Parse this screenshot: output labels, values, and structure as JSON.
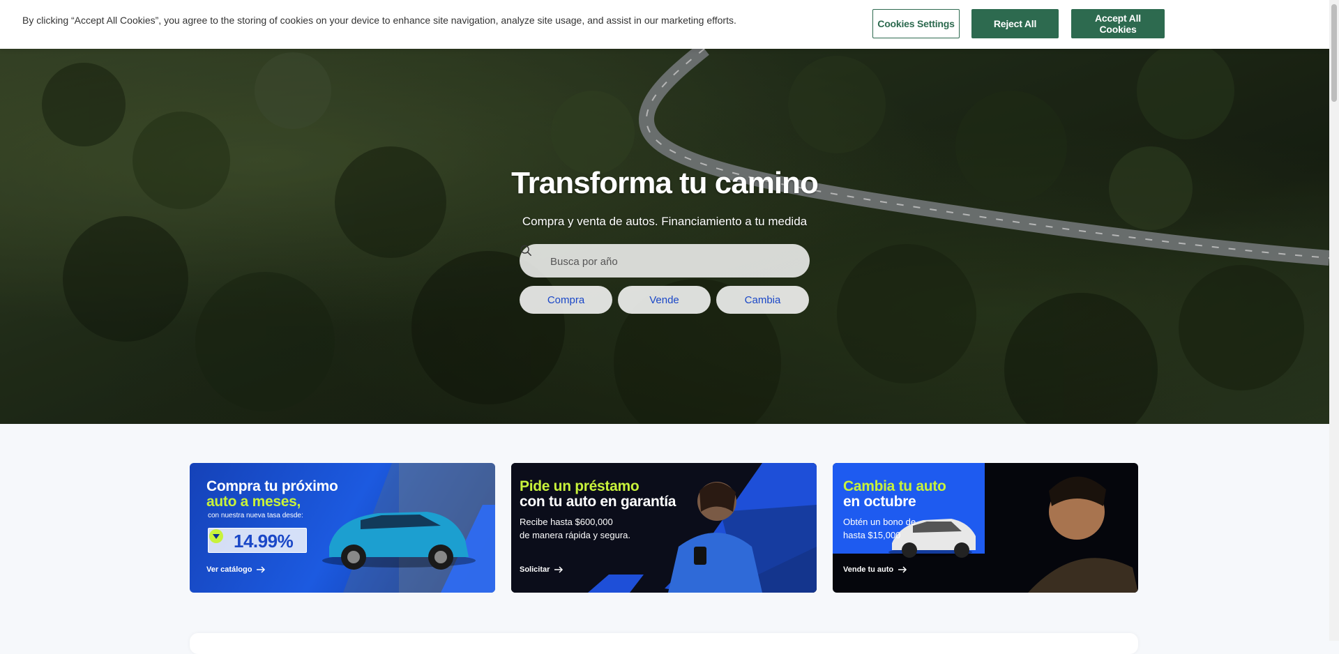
{
  "cookie_banner": {
    "text": "By clicking “Accept All Cookies”, you agree to the storing of cookies on your device to enhance site navigation, analyze site usage, and assist in our marketing efforts.",
    "settings_label": "Cookies Settings",
    "reject_label": "Reject All",
    "accept_label": "Accept All Cookies"
  },
  "hero": {
    "title": "Transforma tu camino",
    "subtitle": "Compra y venta de autos. Financiamiento a tu medida",
    "search_placeholder": "Busca por año",
    "pills": [
      "Compra",
      "Vende",
      "Cambia"
    ]
  },
  "cards": [
    {
      "title_line1": "Compra tu próximo",
      "title_line2": "auto a meses,",
      "small": "con nuestra nueva tasa desde:",
      "rate": "14.99%",
      "link": "Ver catálogo"
    },
    {
      "title_line1": "Pide un préstamo",
      "title_line2": "con tu auto en garantía",
      "desc_line1": "Recibe hasta $600,000",
      "desc_line2": "de manera rápida y segura.",
      "link": "Solicitar"
    },
    {
      "title_line1": "Cambia tu auto",
      "title_line2": "en octubre",
      "desc_line1": "Obtén un bono de",
      "desc_line2": "hasta $15,000",
      "link": "Vende tu auto"
    }
  ],
  "colors": {
    "brand_green": "#2d6a4f",
    "accent_blue": "#1a47c7",
    "lime": "#c8f23b"
  },
  "icons": {
    "search": "search-icon",
    "arrow": "arrow-right-icon",
    "rate_badge": "chevron-down-circle-icon"
  }
}
